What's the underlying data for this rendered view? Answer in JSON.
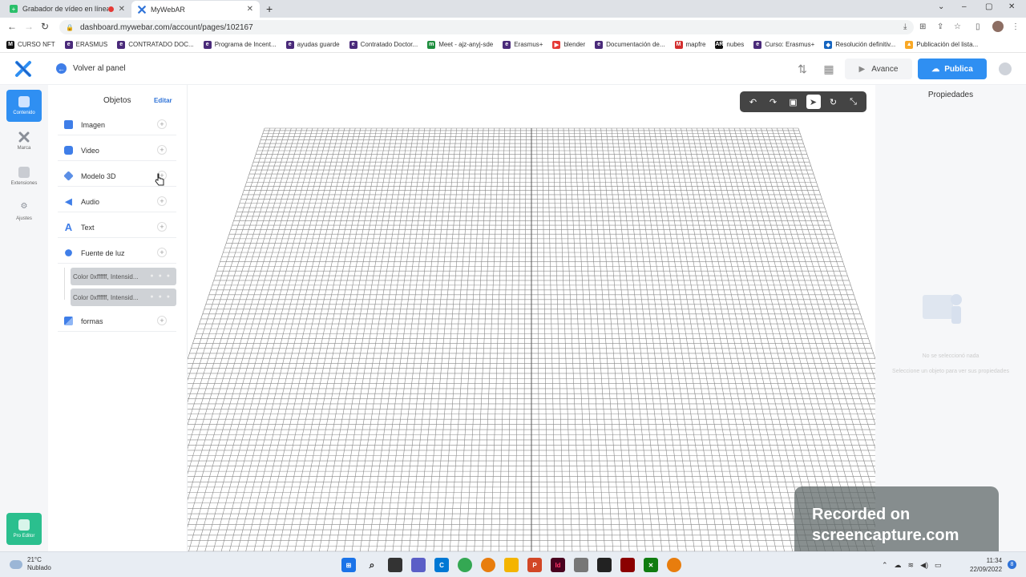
{
  "browser": {
    "tabs": [
      {
        "title": "Grabador de vídeo en línea",
        "recording": true
      },
      {
        "title": "MyWebAR"
      }
    ],
    "url": "dashboard.mywebar.com/account/pages/102167",
    "bookmarks": [
      {
        "label": "CURSO NFT",
        "icon": "M",
        "color": "#111111"
      },
      {
        "label": "ERASMUS",
        "icon": "e",
        "color": "#4a2a7a"
      },
      {
        "label": "CONTRATADO DOC...",
        "icon": "e",
        "color": "#4a2a7a"
      },
      {
        "label": "Programa de Incent...",
        "icon": "e",
        "color": "#4a2a7a"
      },
      {
        "label": "ayudas guarde",
        "icon": "e",
        "color": "#4a2a7a"
      },
      {
        "label": "Contratado Doctor...",
        "icon": "e",
        "color": "#4a2a7a"
      },
      {
        "label": "Meet - ajz-anyj-sde",
        "icon": "m",
        "color": "#1e8e3e"
      },
      {
        "label": "Erasmus+",
        "icon": "e",
        "color": "#4a2a7a"
      },
      {
        "label": "blender",
        "icon": "▶",
        "color": "#e53935"
      },
      {
        "label": "Documentación de...",
        "icon": "e",
        "color": "#4a2a7a"
      },
      {
        "label": "mapfre",
        "icon": "M",
        "color": "#d32f2f"
      },
      {
        "label": "nubes",
        "icon": "AR",
        "color": "#111111"
      },
      {
        "label": "Curso: Erasmus+",
        "icon": "e",
        "color": "#4a2a7a"
      },
      {
        "label": "Resolución definitiv...",
        "icon": "◆",
        "color": "#1565c0"
      },
      {
        "label": "Publicación del lista...",
        "icon": "▲",
        "color": "#f9a825"
      }
    ]
  },
  "header": {
    "back_label": "Volver al panel",
    "preview_label": "Avance",
    "publish_label": "Publica",
    "accent": "#2f8ff2"
  },
  "rail": {
    "items": [
      {
        "label": "Contenido",
        "active": true
      },
      {
        "label": "Marca"
      },
      {
        "label": "Extensiones"
      },
      {
        "label": "Ajustes"
      }
    ],
    "pro_label": "Pro Editor"
  },
  "objects": {
    "title": "Objetos",
    "edit_label": "Editar",
    "items": [
      {
        "label": "Imagen",
        "icon": "image-icon"
      },
      {
        "label": "Video",
        "icon": "video-icon"
      },
      {
        "label": "Modelo 3D",
        "icon": "cube-icon"
      },
      {
        "label": "Audio",
        "icon": "speaker-icon"
      },
      {
        "label": "Text",
        "icon": "text-icon"
      },
      {
        "label": "Fuente de luz",
        "icon": "light-icon"
      }
    ],
    "light_children": [
      "Color 0xffffff, Intensid...",
      "Color 0xffffff, Intensid..."
    ],
    "shapes_label": "formas"
  },
  "properties": {
    "title": "Propiedades",
    "empty_title": "No se seleccionó nada",
    "empty_hint": "Seleccione un objeto para ver sus propiedades"
  },
  "watermark": {
    "line1": "Recorded on",
    "line2": "screencapture.com"
  },
  "taskbar": {
    "temperature": "21°C",
    "condition": "Nublado",
    "time": "11:34",
    "date": "22/09/2022",
    "notifications": "8"
  }
}
